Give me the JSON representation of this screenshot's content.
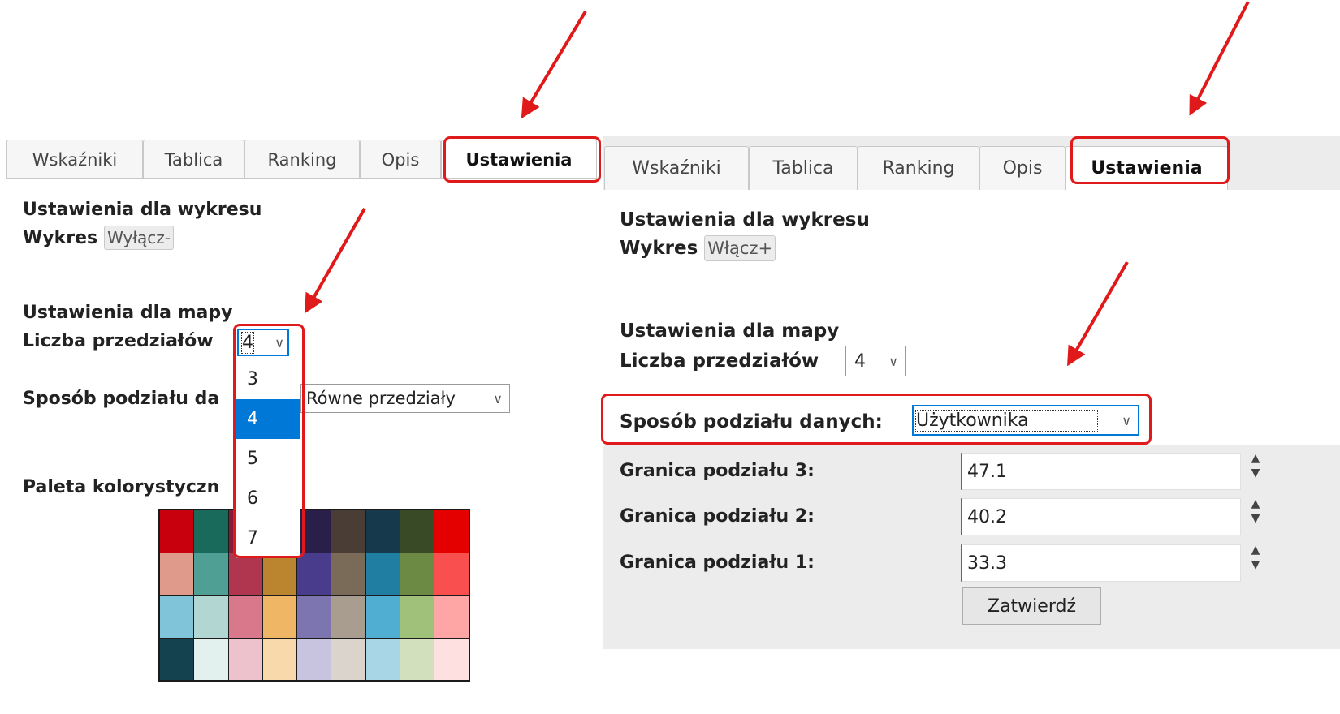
{
  "left": {
    "tabs": [
      "Wskaźniki",
      "Tablica",
      "Ranking",
      "Opis",
      "Ustawienia"
    ],
    "chart_heading": "Ustawienia dla wykresu",
    "chart_label": "Wykres",
    "chart_toggle": "Wyłącz-",
    "map_heading": "Ustawienia dla mapy",
    "intervals_label": "Liczba przedziałów",
    "intervals_value": "4",
    "intervals_options": [
      "3",
      "4",
      "5",
      "6",
      "7"
    ],
    "intervals_selected": "4",
    "division_label": "Sposób podziału da",
    "division_value": "Równe przedziały",
    "palette_label": "Paleta kolorystyczn",
    "palette_colors": [
      [
        "#c8000e",
        "#1a6a5c",
        "#8a1b36",
        "#bf6f0f",
        "#2a1f4a",
        "#4a3d35",
        "#163a4b",
        "#394a26",
        "#e50000"
      ],
      [
        "#e09a8c",
        "#4f9f95",
        "#b0364f",
        "#bb8530",
        "#4a3c8c",
        "#7a6b58",
        "#1f7ea1",
        "#6d8a45",
        "#fa4f4f"
      ],
      [
        "#7fc4d8",
        "#b2d6d1",
        "#d9788a",
        "#efb666",
        "#7d75b0",
        "#a89d8e",
        "#50aed3",
        "#a0c17a",
        "#fea6a6"
      ],
      [
        "#15424f",
        "#e3f1ee",
        "#edc2cc",
        "#f8d9ab",
        "#c8c4df",
        "#dad4cd",
        "#a8d6e6",
        "#d3e0be",
        "#fee0e0"
      ]
    ]
  },
  "right": {
    "tabs": [
      "Wskaźniki",
      "Tablica",
      "Ranking",
      "Opis",
      "Ustawienia"
    ],
    "chart_heading": "Ustawienia dla wykresu",
    "chart_label": "Wykres",
    "chart_toggle": "Włącz+",
    "map_heading": "Ustawienia dla mapy",
    "intervals_label": "Liczba przedziałów",
    "intervals_value": "4",
    "division_label": "Sposób podziału danych:",
    "division_value": "Użytkownika",
    "boundaries": [
      {
        "label": "Granica podziału 3:",
        "value": "47.1"
      },
      {
        "label": "Granica podziału 2:",
        "value": "40.2"
      },
      {
        "label": "Granica podziału 1:",
        "value": "33.3"
      }
    ],
    "submit": "Zatwierdź"
  },
  "annotation_color": "#e01a1a"
}
